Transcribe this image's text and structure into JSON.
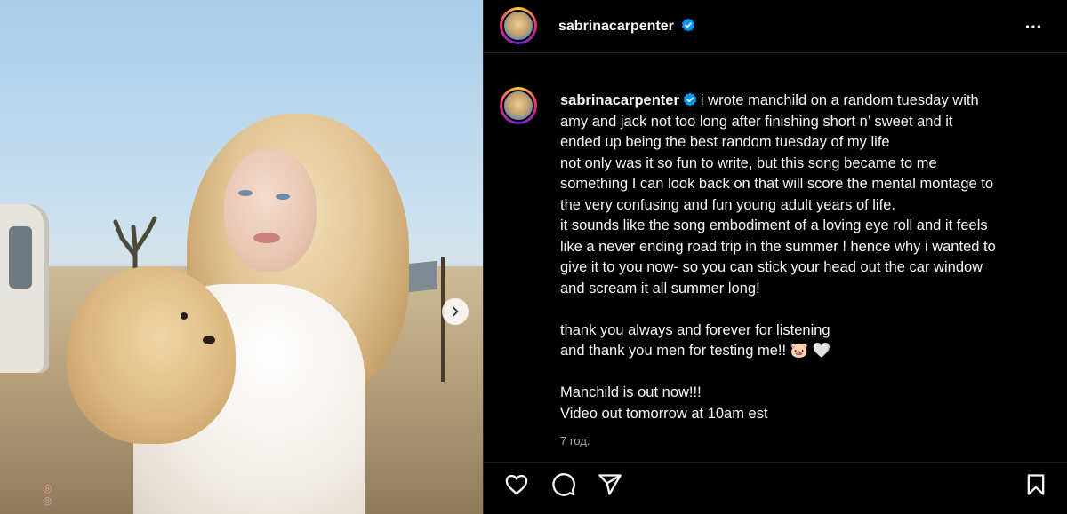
{
  "post": {
    "username": "sabrinacarpenter",
    "caption_lines": [
      "i wrote manchild on a random tuesday with",
      "amy and jack not too long after finishing short n’ sweet and it",
      "ended up being the best random tuesday of my life",
      "not only was it so fun to write, but this song became to me",
      "something I can look back on that will score the mental montage to",
      "the very confusing and fun young adult years of life.",
      "it sounds like the song embodiment of a loving eye roll and it feels",
      "like a never ending road trip in the summer ! hence why i wanted to",
      "give it to you now- so you can stick your head out the car window",
      "and scream it all summer long!",
      "",
      "thank you always and forever for listening",
      "and thank you men for testing me!! 🐷 🤍",
      "",
      "Manchild is out now!!!",
      "Video out tomorrow at 10am est"
    ],
    "time": "7 год."
  },
  "icons": {
    "verified": "verified-badge-icon",
    "more": "more-options-icon",
    "next": "chevron-right-icon",
    "like": "heart-icon",
    "comment": "comment-icon",
    "share": "paper-plane-icon",
    "save": "bookmark-icon"
  },
  "colors": {
    "background": "#000000",
    "verified": "#0095f6",
    "muted_text": "#a8a8a8"
  }
}
